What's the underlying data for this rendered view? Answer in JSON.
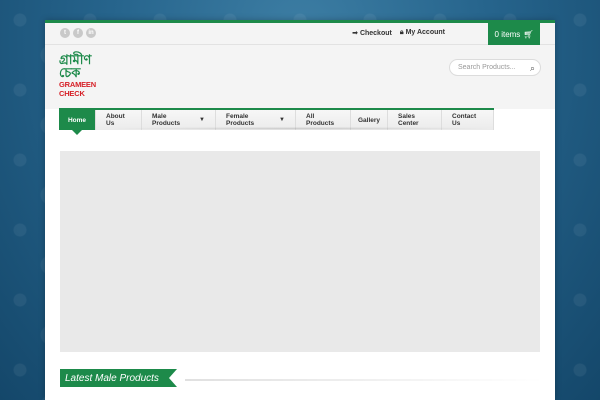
{
  "topbar": {
    "social": [
      "t",
      "f",
      "in"
    ],
    "checkout_label": "Checkout",
    "account_label": "My Account",
    "cart_label": "0 items"
  },
  "header": {
    "logo_bangla": "গ্রামীণ চেক",
    "logo_english": "GRAMEEN CHECK",
    "search_placeholder": "Search Products..."
  },
  "nav": {
    "items": [
      {
        "label": "Home"
      },
      {
        "label": "About Us"
      },
      {
        "label": "Male Products"
      },
      {
        "label": "Female Products"
      },
      {
        "label": "All Products"
      },
      {
        "label": "Gallery"
      },
      {
        "label": "Sales Center"
      },
      {
        "label": "Contact Us"
      }
    ]
  },
  "section": {
    "title": "Latest Male Products"
  },
  "colors": {
    "accent": "#1d8a4a",
    "logo_red": "#d62027"
  }
}
